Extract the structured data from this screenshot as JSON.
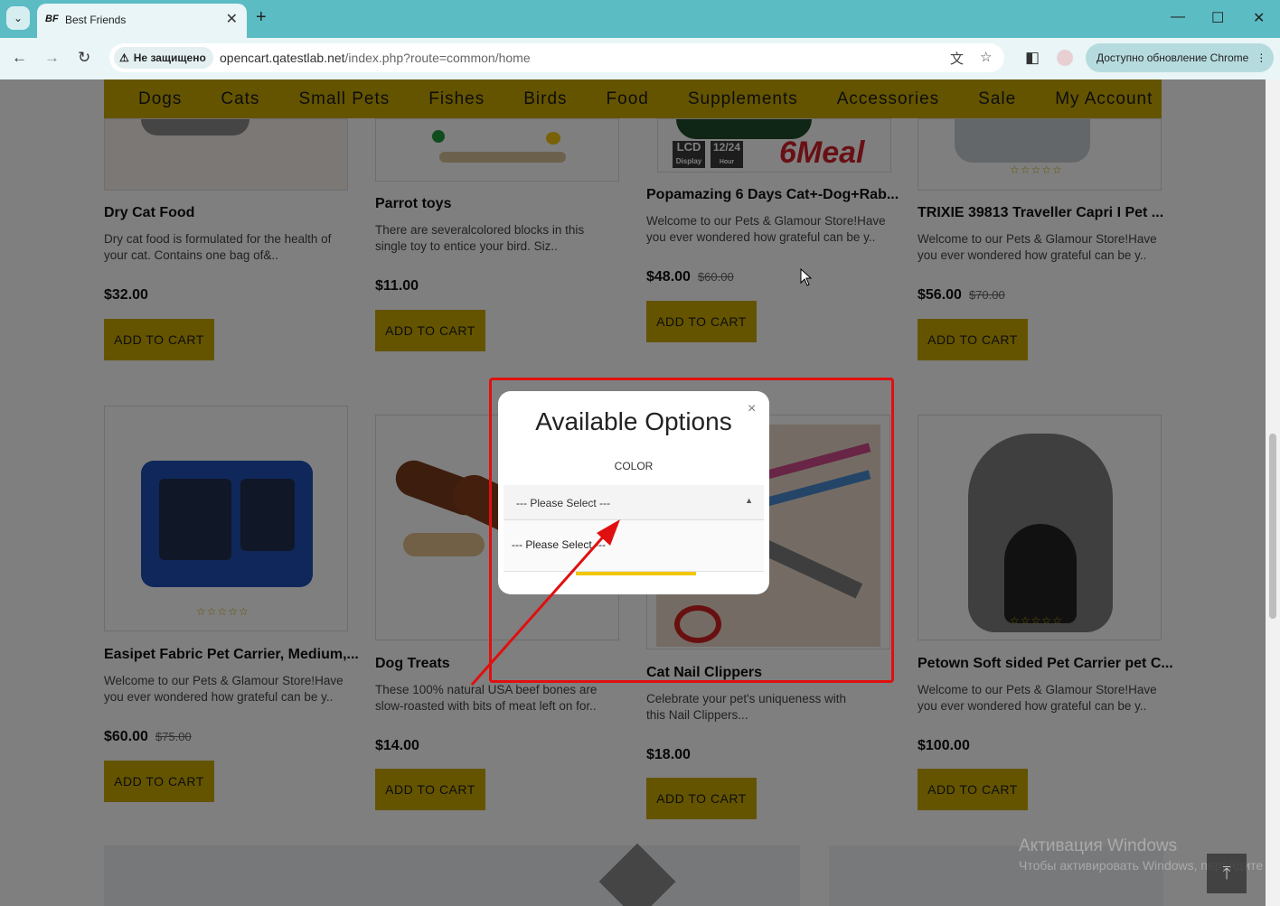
{
  "browser": {
    "tab_title": "Best Friends",
    "tab_favicon": "BF",
    "secure_label": "Не защищено",
    "url_host": "opencart.qatestlab.net",
    "url_path": "/index.php?route=common/home",
    "update_button": "Доступно обновление Chrome"
  },
  "nav": {
    "items": [
      "Dogs",
      "Cats",
      "Small Pets",
      "Fishes",
      "Birds",
      "Food",
      "Supplements",
      "Accessories",
      "Sale",
      "My Account"
    ]
  },
  "products_row1": [
    {
      "title": "Dry Cat Food",
      "desc": "Dry cat food is formulated for the health of your cat. Contains one bag of&..",
      "price": "$32.00",
      "old": "",
      "cart": "ADD TO CART"
    },
    {
      "title": "Parrot toys",
      "desc": "There are severalcolored blocks in this single toy to entice your bird. Siz..",
      "price": "$11.00",
      "old": "",
      "cart": "ADD TO CART"
    },
    {
      "title": "Popamazing 6 Days Cat+-Dog+Rab...",
      "desc": "Welcome to our Pets & Glamour Store!Have you ever wondered how grateful can be y..",
      "price": "$48.00",
      "old": "$60.00",
      "cart": "ADD TO CART"
    },
    {
      "title": "TRIXIE 39813 Traveller Capri I Pet ...",
      "desc": "Welcome to our Pets & Glamour Store!Have you ever wondered how grateful can be y..",
      "price": "$56.00",
      "old": "$70.00",
      "cart": "ADD TO CART"
    }
  ],
  "products_row2": [
    {
      "title": "Easipet Fabric Pet Carrier, Medium,...",
      "desc": "Welcome to our Pets & Glamour Store!Have you ever wondered how grateful can be y..",
      "price": "$60.00",
      "old": "$75.00",
      "cart": "ADD TO CART"
    },
    {
      "title": "Dog Treats",
      "desc": "These 100% natural USA beef bones are slow-roasted with bits of meat left on for..",
      "price": "$14.00",
      "old": "",
      "cart": "ADD TO CART"
    },
    {
      "title": "Cat Nail Clippers",
      "desc": "Celebrate your pet's uniqueness with this Nail Clippers...",
      "price": "$18.00",
      "old": "",
      "cart": "ADD TO CART"
    },
    {
      "title": "Petown Soft sided Pet Carrier pet C...",
      "desc": "Welcome to our Pets & Glamour Store!Have you ever wondered how grateful can be y..",
      "price": "$100.00",
      "old": "",
      "cart": "ADD TO CART"
    }
  ],
  "image_labels": {
    "lcd": "LCD",
    "lcd_sub": "Display",
    "clock": "12/24",
    "clock_sub": "Hour Clock",
    "brand": "6Meal"
  },
  "modal": {
    "title": "Available Options",
    "color_label": "COLOR",
    "select_value": "--- Please Select ---",
    "option_1": "--- Please Select ---",
    "close": "×"
  },
  "watermark": {
    "line1": "Активация Windows",
    "line2": "Чтобы активировать Windows, перейдите"
  },
  "colors": {
    "accent": "#c8a800",
    "annotation": "#e01010",
    "chrome": "#5cbcc4"
  }
}
